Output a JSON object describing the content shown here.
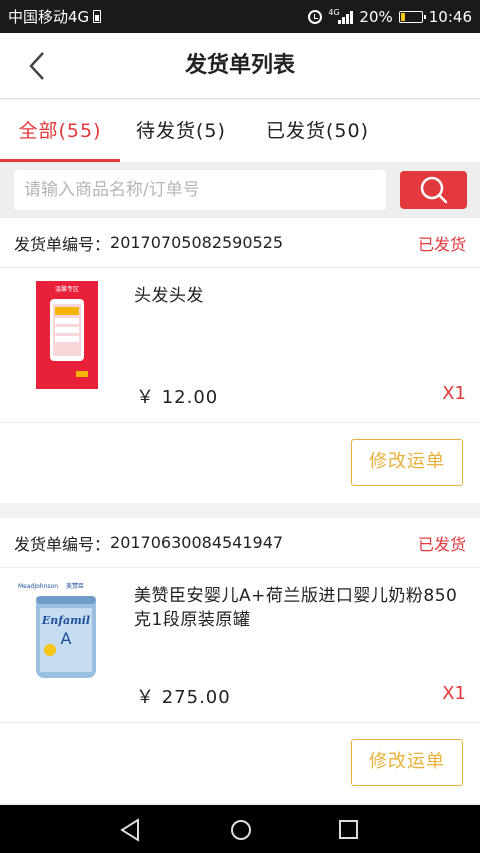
{
  "status_bar": {
    "carrier": "中国移动4G",
    "network_badge": "4G",
    "battery_percent": "20%",
    "time": "10:46",
    "icons": [
      "sim-icon",
      "alarm-icon",
      "signal-icon",
      "battery-icon"
    ]
  },
  "navbar": {
    "title": "发货单列表",
    "back_icon": "chevron-left-icon"
  },
  "tabs": [
    {
      "label": "全部(55)",
      "active": true
    },
    {
      "label": "待发货(5)",
      "active": false
    },
    {
      "label": "已发货(50)",
      "active": false
    }
  ],
  "search": {
    "placeholder": "请输入商品名称/订单号",
    "value": "",
    "button_icon": "search-icon"
  },
  "orders": [
    {
      "number_label": "发货单编号：",
      "number": "20170705082590525",
      "status": "已发货",
      "goods_name": "头发头发",
      "price": "￥ 12.00",
      "qty": "X1",
      "action": "修改运单"
    },
    {
      "number_label": "发货单编号：",
      "number": "20170630084541947",
      "status": "已发货",
      "goods_name": "美赞臣安婴儿A+荷兰版进口婴儿奶粉850克1段原装原罐",
      "price": "￥ 275.00",
      "qty": "X1",
      "action": "修改运单"
    }
  ],
  "product_images": {
    "first_brand_text": "温馨专区",
    "second_brand_text": "Enfamil",
    "second_logo_text": "美赞臣",
    "second_logo_text_en": "MeadJohnson"
  },
  "colors": {
    "accent": "#e4393c",
    "action": "#e8b13a",
    "status_bar": "#1a1a1a"
  }
}
